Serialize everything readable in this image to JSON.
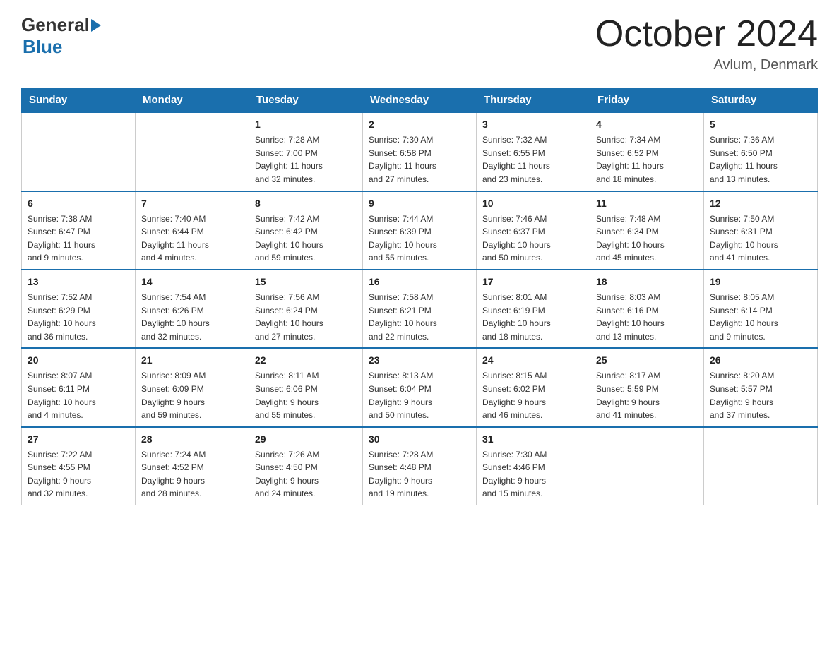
{
  "header": {
    "logo_general": "General",
    "logo_blue": "Blue",
    "month_title": "October 2024",
    "location": "Avlum, Denmark"
  },
  "calendar": {
    "days_of_week": [
      "Sunday",
      "Monday",
      "Tuesday",
      "Wednesday",
      "Thursday",
      "Friday",
      "Saturday"
    ],
    "weeks": [
      [
        {
          "day": "",
          "info": ""
        },
        {
          "day": "",
          "info": ""
        },
        {
          "day": "1",
          "info": "Sunrise: 7:28 AM\nSunset: 7:00 PM\nDaylight: 11 hours\nand 32 minutes."
        },
        {
          "day": "2",
          "info": "Sunrise: 7:30 AM\nSunset: 6:58 PM\nDaylight: 11 hours\nand 27 minutes."
        },
        {
          "day": "3",
          "info": "Sunrise: 7:32 AM\nSunset: 6:55 PM\nDaylight: 11 hours\nand 23 minutes."
        },
        {
          "day": "4",
          "info": "Sunrise: 7:34 AM\nSunset: 6:52 PM\nDaylight: 11 hours\nand 18 minutes."
        },
        {
          "day": "5",
          "info": "Sunrise: 7:36 AM\nSunset: 6:50 PM\nDaylight: 11 hours\nand 13 minutes."
        }
      ],
      [
        {
          "day": "6",
          "info": "Sunrise: 7:38 AM\nSunset: 6:47 PM\nDaylight: 11 hours\nand 9 minutes."
        },
        {
          "day": "7",
          "info": "Sunrise: 7:40 AM\nSunset: 6:44 PM\nDaylight: 11 hours\nand 4 minutes."
        },
        {
          "day": "8",
          "info": "Sunrise: 7:42 AM\nSunset: 6:42 PM\nDaylight: 10 hours\nand 59 minutes."
        },
        {
          "day": "9",
          "info": "Sunrise: 7:44 AM\nSunset: 6:39 PM\nDaylight: 10 hours\nand 55 minutes."
        },
        {
          "day": "10",
          "info": "Sunrise: 7:46 AM\nSunset: 6:37 PM\nDaylight: 10 hours\nand 50 minutes."
        },
        {
          "day": "11",
          "info": "Sunrise: 7:48 AM\nSunset: 6:34 PM\nDaylight: 10 hours\nand 45 minutes."
        },
        {
          "day": "12",
          "info": "Sunrise: 7:50 AM\nSunset: 6:31 PM\nDaylight: 10 hours\nand 41 minutes."
        }
      ],
      [
        {
          "day": "13",
          "info": "Sunrise: 7:52 AM\nSunset: 6:29 PM\nDaylight: 10 hours\nand 36 minutes."
        },
        {
          "day": "14",
          "info": "Sunrise: 7:54 AM\nSunset: 6:26 PM\nDaylight: 10 hours\nand 32 minutes."
        },
        {
          "day": "15",
          "info": "Sunrise: 7:56 AM\nSunset: 6:24 PM\nDaylight: 10 hours\nand 27 minutes."
        },
        {
          "day": "16",
          "info": "Sunrise: 7:58 AM\nSunset: 6:21 PM\nDaylight: 10 hours\nand 22 minutes."
        },
        {
          "day": "17",
          "info": "Sunrise: 8:01 AM\nSunset: 6:19 PM\nDaylight: 10 hours\nand 18 minutes."
        },
        {
          "day": "18",
          "info": "Sunrise: 8:03 AM\nSunset: 6:16 PM\nDaylight: 10 hours\nand 13 minutes."
        },
        {
          "day": "19",
          "info": "Sunrise: 8:05 AM\nSunset: 6:14 PM\nDaylight: 10 hours\nand 9 minutes."
        }
      ],
      [
        {
          "day": "20",
          "info": "Sunrise: 8:07 AM\nSunset: 6:11 PM\nDaylight: 10 hours\nand 4 minutes."
        },
        {
          "day": "21",
          "info": "Sunrise: 8:09 AM\nSunset: 6:09 PM\nDaylight: 9 hours\nand 59 minutes."
        },
        {
          "day": "22",
          "info": "Sunrise: 8:11 AM\nSunset: 6:06 PM\nDaylight: 9 hours\nand 55 minutes."
        },
        {
          "day": "23",
          "info": "Sunrise: 8:13 AM\nSunset: 6:04 PM\nDaylight: 9 hours\nand 50 minutes."
        },
        {
          "day": "24",
          "info": "Sunrise: 8:15 AM\nSunset: 6:02 PM\nDaylight: 9 hours\nand 46 minutes."
        },
        {
          "day": "25",
          "info": "Sunrise: 8:17 AM\nSunset: 5:59 PM\nDaylight: 9 hours\nand 41 minutes."
        },
        {
          "day": "26",
          "info": "Sunrise: 8:20 AM\nSunset: 5:57 PM\nDaylight: 9 hours\nand 37 minutes."
        }
      ],
      [
        {
          "day": "27",
          "info": "Sunrise: 7:22 AM\nSunset: 4:55 PM\nDaylight: 9 hours\nand 32 minutes."
        },
        {
          "day": "28",
          "info": "Sunrise: 7:24 AM\nSunset: 4:52 PM\nDaylight: 9 hours\nand 28 minutes."
        },
        {
          "day": "29",
          "info": "Sunrise: 7:26 AM\nSunset: 4:50 PM\nDaylight: 9 hours\nand 24 minutes."
        },
        {
          "day": "30",
          "info": "Sunrise: 7:28 AM\nSunset: 4:48 PM\nDaylight: 9 hours\nand 19 minutes."
        },
        {
          "day": "31",
          "info": "Sunrise: 7:30 AM\nSunset: 4:46 PM\nDaylight: 9 hours\nand 15 minutes."
        },
        {
          "day": "",
          "info": ""
        },
        {
          "day": "",
          "info": ""
        }
      ]
    ]
  }
}
